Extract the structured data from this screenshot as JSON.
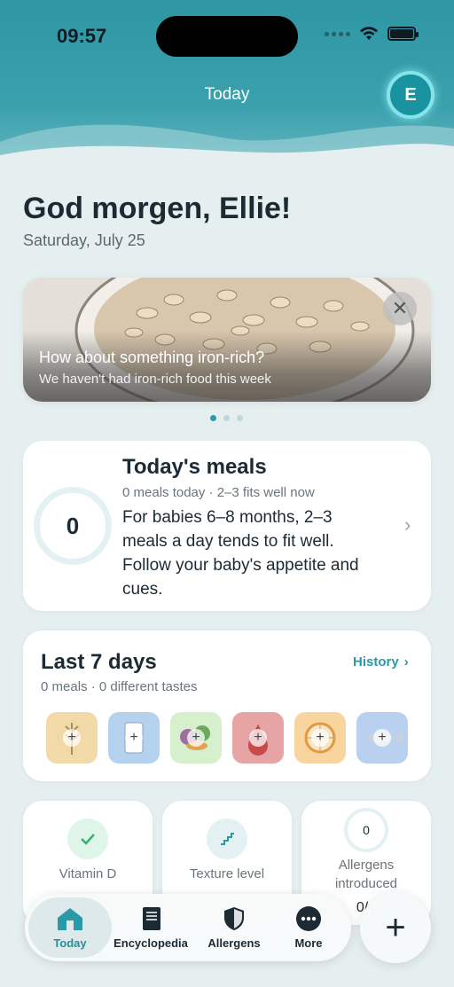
{
  "status": {
    "time": "09:57"
  },
  "nav": {
    "title": "Today",
    "avatar_initial": "E"
  },
  "greeting": {
    "title": "God morgen, Ellie!",
    "date": "Saturday, July 25"
  },
  "banner": {
    "title": "How about something iron-rich?",
    "subtitle": "We haven't had iron-rich food this week",
    "close_icon": "close-icon",
    "pages": 3,
    "active_page": 0
  },
  "meals": {
    "count": "0",
    "title": "Today's meals",
    "subtitle": "0 meals today · 2–3 fits well now",
    "description": "For babies 6–8 months, 2–3 meals a day tends to fit well. Follow your baby's appetite and cues."
  },
  "week": {
    "title": "Last 7 days",
    "subtitle": "0 meals · 0 different tastes",
    "history_label": "History",
    "foods": [
      {
        "name": "grain",
        "color": "#f1d9a8",
        "icon": "wheat-icon"
      },
      {
        "name": "milk",
        "color": "#b4d2ee",
        "icon": "milk-glass-icon"
      },
      {
        "name": "vegetables",
        "color": "#d6efcd",
        "icon": "vegetables-icon"
      },
      {
        "name": "iron",
        "color": "#e6a4a4",
        "icon": "blood-drop-icon"
      },
      {
        "name": "citrus",
        "color": "#f8d59e",
        "icon": "orange-slice-icon"
      },
      {
        "name": "fish",
        "color": "#b9d0ee",
        "icon": "fish-icon"
      }
    ]
  },
  "stats": {
    "vitamin_d": {
      "label": "Vitamin D",
      "icon": "checkmark-icon"
    },
    "texture": {
      "label": "Texture level",
      "icon": "stairs-icon"
    },
    "allergens": {
      "count": "0",
      "label_line1": "Allergens",
      "label_line2": "introduced",
      "value": "0/1"
    }
  },
  "tabs": [
    {
      "label": "Today",
      "icon": "home-icon"
    },
    {
      "label": "Encyclopedia",
      "icon": "book-icon"
    },
    {
      "label": "Allergens",
      "icon": "shield-icon"
    },
    {
      "label": "More",
      "icon": "more-icon"
    }
  ],
  "fab": {
    "icon": "plus-icon"
  }
}
